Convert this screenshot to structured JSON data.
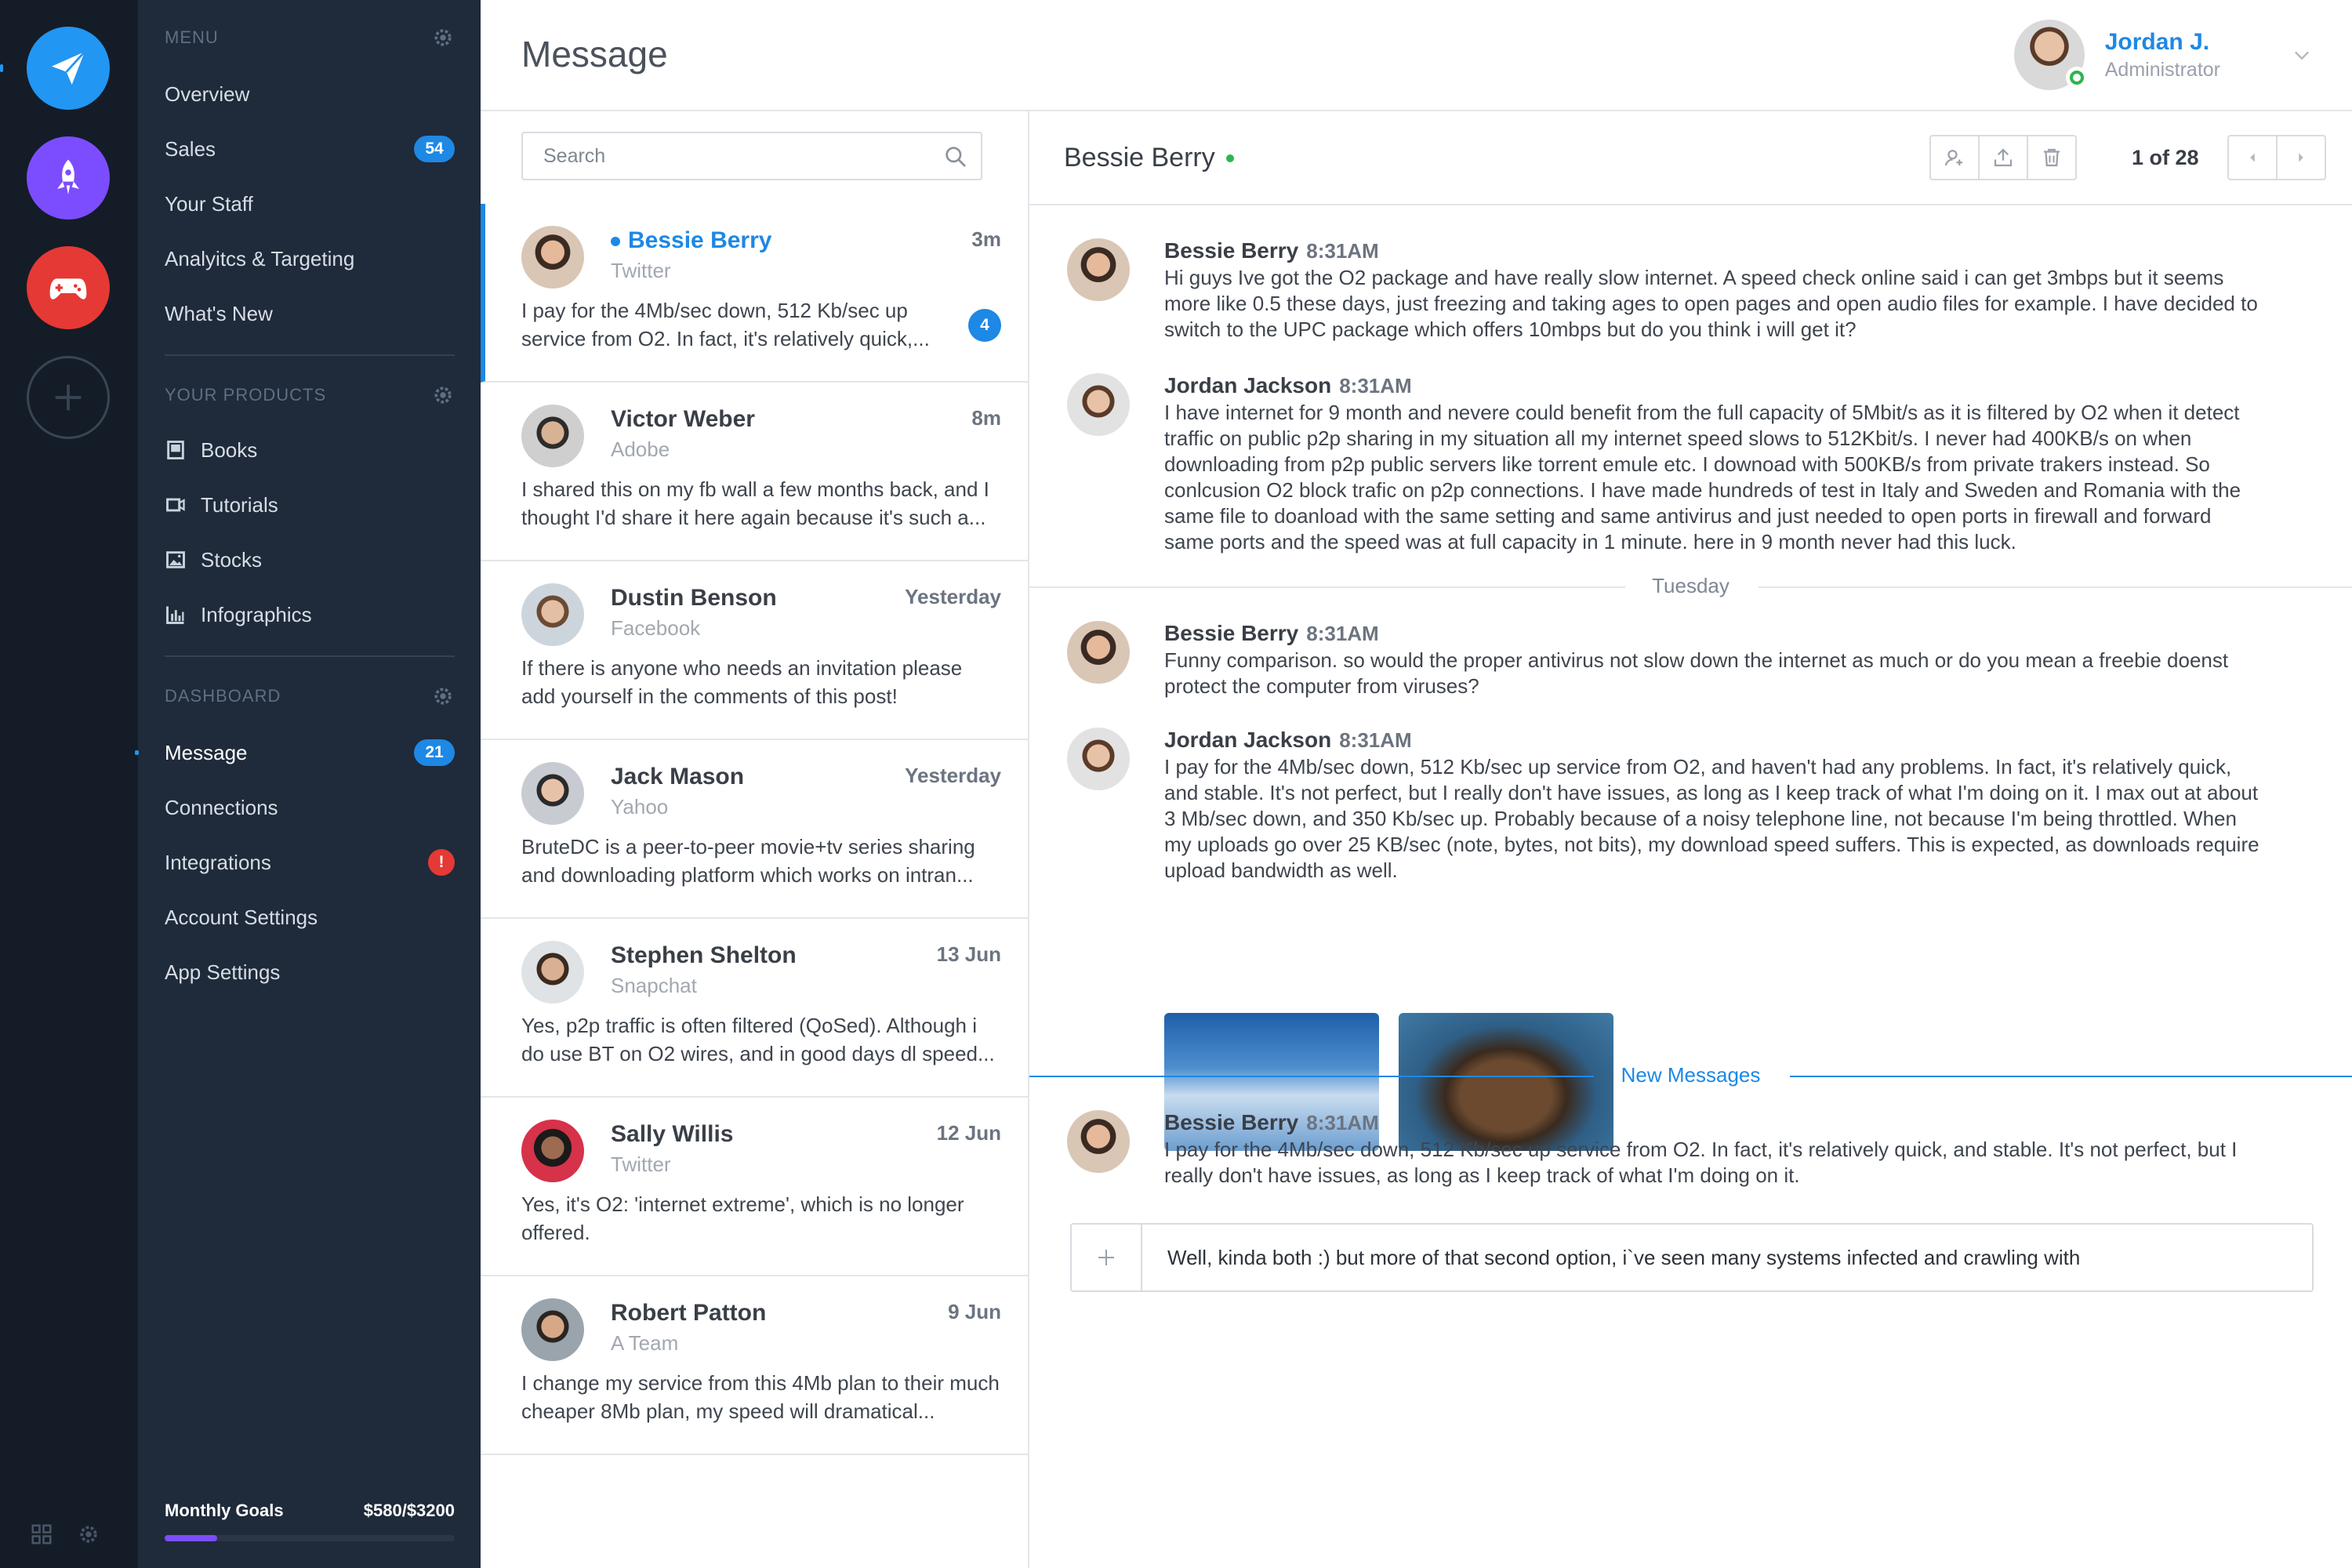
{
  "rail": {
    "apps": [
      {
        "name": "send-app",
        "icon": "paper-plane-icon",
        "color": "#2196f3"
      },
      {
        "name": "rocket-app",
        "icon": "rocket-icon",
        "color": "#7c4dff"
      },
      {
        "name": "game-app",
        "icon": "gamepad-icon",
        "color": "#e53935"
      }
    ]
  },
  "menu": {
    "section1": {
      "title": "MENU"
    },
    "section1_items": [
      {
        "label": "Overview"
      },
      {
        "label": "Sales",
        "badge": "54"
      },
      {
        "label": "Your Staff"
      },
      {
        "label": "Analyitcs & Targeting"
      },
      {
        "label": "What's New"
      }
    ],
    "section2": {
      "title": "YOUR PRODUCTS"
    },
    "section2_items": [
      {
        "label": "Books",
        "icon": "book-icon"
      },
      {
        "label": "Tutorials",
        "icon": "video-icon"
      },
      {
        "label": "Stocks",
        "icon": "image-icon"
      },
      {
        "label": "Infographics",
        "icon": "bar-chart-icon"
      }
    ],
    "section3": {
      "title": "DASHBOARD"
    },
    "section3_items": [
      {
        "label": "Message",
        "badge": "21",
        "active": true
      },
      {
        "label": "Connections"
      },
      {
        "label": "Integrations",
        "badge": "!"
      },
      {
        "label": "Account Settings"
      },
      {
        "label": "App Settings"
      }
    ],
    "goals": {
      "label": "Monthly Goals",
      "value": "$580/$3200",
      "progress": 0.18
    }
  },
  "header": {
    "title": "Message",
    "user": {
      "name": "Jordan J.",
      "role": "Administrator"
    }
  },
  "list": {
    "search_placeholder": "Search",
    "items": [
      {
        "name": "Bessie Berry",
        "source": "Twitter",
        "time": "3m",
        "preview": "I pay for the 4Mb/sec down, 512 Kb/sec up service from O2. In fact, it's relatively quick,...",
        "count": "4",
        "selected": true,
        "unread": true
      },
      {
        "name": "Victor Weber",
        "source": "Adobe",
        "time": "8m",
        "preview": "I shared this on my fb wall a few months back, and I thought I'd share it here again because it's such a..."
      },
      {
        "name": "Dustin Benson",
        "source": "Facebook",
        "time": "Yesterday",
        "preview": "If there is anyone who needs an invitation please add yourself in the comments of this post!"
      },
      {
        "name": "Jack Mason",
        "source": "Yahoo",
        "time": "Yesterday",
        "preview": "BruteDC is a peer-to-peer movie+tv series sharing and downloading platform which works on intran..."
      },
      {
        "name": "Stephen Shelton",
        "source": "Snapchat",
        "time": "13 Jun",
        "preview": "Yes, p2p traffic is often filtered (QoSed). Although i do use BT on O2 wires, and in good days dl speed..."
      },
      {
        "name": "Sally Willis",
        "source": "Twitter",
        "time": "12 Jun",
        "preview": "Yes, it's O2: 'internet extreme', which is no longer offered."
      },
      {
        "name": "Robert Patton",
        "source": "A Team",
        "time": "9 Jun",
        "preview": "I change my service from this 4Mb plan to their much cheaper 8Mb plan, my speed will dramatical..."
      }
    ]
  },
  "conversation": {
    "contact": "Bessie Berry",
    "pager": "1 of 28",
    "messages": [
      {
        "author": "Bessie Berry",
        "time": "8:31AM",
        "text": "Hi guys Ive got the O2 package and have really slow internet. A speed check online said i can get 3mbps but it seems more like 0.5 these days, just freezing and taking ages to open pages and open audio files for example. I have decided to switch to the UPC package which offers 10mbps but do you think i will get it?"
      },
      {
        "author": "Jordan Jackson",
        "time": "8:31AM",
        "text": "I have internet for 9 month and nevere could benefit from the full capacity of 5Mbit/s as it is filtered by O2 when it detect traffic on public p2p sharing in my situation all my internet speed slows to 512Kbit/s. I never had 400KB/s on when downloading from p2p public servers like torrent emule etc. I downoad with 500KB/s from private trakers instead. So conlcusion O2 block trafic on p2p connections. I have made hundreds of test in Italy and Sweden and Romania with the same file to doanload with the same setting and same antivirus and just needed to open ports in firewall and forward same ports and the speed was at full capacity in 1 minute. here in 9 month never had this luck."
      },
      {
        "author": "Bessie Berry",
        "time": "8:31AM",
        "text": "Funny comparison. so would the proper antivirus not slow down the internet as much or do you mean a freebie doenst protect the computer from viruses?"
      },
      {
        "author": "Jordan Jackson",
        "time": "8:31AM",
        "text": "I pay for the 4Mb/sec down, 512 Kb/sec up service from O2, and haven't had any problems. In fact, it's relatively quick, and stable. It's not perfect, but I really don't have issues, as long as I keep track of what I'm doing on it. I max out at about 3 Mb/sec down, and 350 Kb/sec up. Probably because of a noisy telephone line, not because I'm being throttled. When my uploads go over 25 KB/sec (note, bytes, not bits), my download speed suffers. This is expected, as downloads require upload bandwidth as well."
      },
      {
        "author": "Bessie Berry",
        "time": "8:31AM",
        "text": "I pay for the 4Mb/sec down, 512 Kb/sec up service from O2. In fact, it's relatively quick, and stable. It's not perfect, but I really don't have issues, as long as I keep track of what I'm doing on it."
      }
    ],
    "separator_day": "Tuesday",
    "separator_new": "New Messages",
    "composer_value": "Well, kinda both :) but more of that second option, i`ve seen many systems infected and crawling with"
  }
}
